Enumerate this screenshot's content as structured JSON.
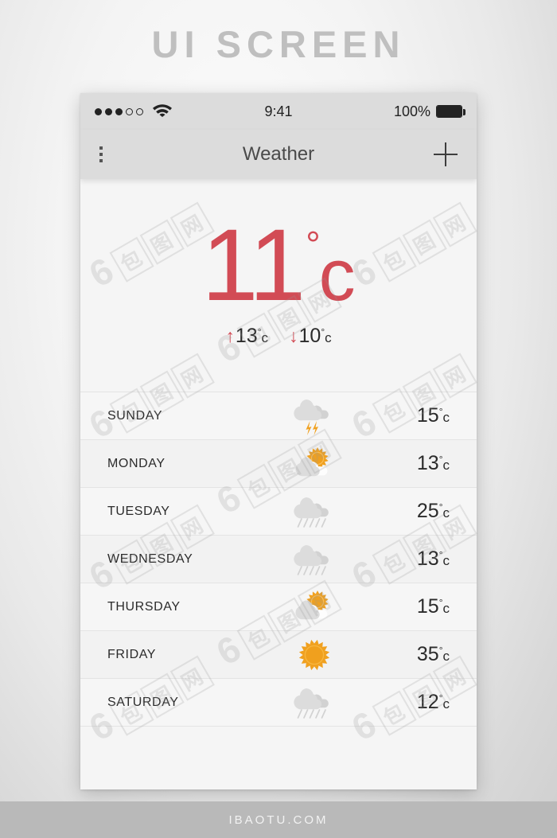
{
  "poster": {
    "title": "UI SCREEN",
    "footer": "IBAOTU.COM",
    "watermark": "6 包图网"
  },
  "statusbar": {
    "signal_filled": 3,
    "signal_empty": 2,
    "wifi_icon": "wifi-icon",
    "time": "9:41",
    "battery_percent": "100%",
    "battery_icon": "battery-full-icon"
  },
  "navbar": {
    "menu_icon": "kebab-menu-icon",
    "title": "Weather",
    "add_icon": "plus-icon"
  },
  "current": {
    "temperature": "11",
    "degree_symbol": "°",
    "unit": "c",
    "high_arrow": "↑",
    "high_value": "13",
    "high_degree": "°",
    "high_unit": "c",
    "low_arrow": "↓",
    "low_value": "10",
    "low_degree": "°",
    "low_unit": "c"
  },
  "forecast": [
    {
      "day": "SUNDAY",
      "icon": "thunderstorm-icon",
      "temp": "15",
      "degree": "°",
      "unit": "c"
    },
    {
      "day": "MONDAY",
      "icon": "partly-cloudy-icon",
      "temp": "13",
      "degree": "°",
      "unit": "c"
    },
    {
      "day": "TUESDAY",
      "icon": "rain-cloud-icon",
      "temp": "25",
      "degree": "°",
      "unit": "c"
    },
    {
      "day": "WEDNESDAY",
      "icon": "rain-cloud-icon",
      "temp": "13",
      "degree": "°",
      "unit": "c"
    },
    {
      "day": "THURSDAY",
      "icon": "partly-cloudy-icon",
      "temp": "15",
      "degree": "°",
      "unit": "c"
    },
    {
      "day": "FRIDAY",
      "icon": "sun-icon",
      "temp": "35",
      "degree": "°",
      "unit": "c"
    },
    {
      "day": "SATURDAY",
      "icon": "rain-cloud-icon",
      "temp": "12",
      "degree": "°",
      "unit": "c"
    }
  ],
  "colors": {
    "accent_red": "#d24b55",
    "sun_orange": "#f0a01e",
    "cloud_gray": "#dcdcdc",
    "chrome_gray": "#dcdcdc",
    "screen_bg": "#f5f5f5",
    "footer_bg": "#b9b9b9"
  }
}
